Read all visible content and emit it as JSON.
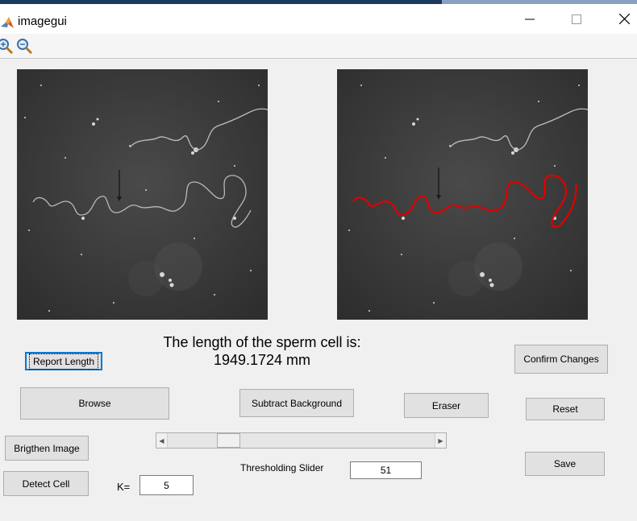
{
  "window": {
    "title": "imagegui"
  },
  "toolbar": {
    "zoom_in_icon": "zoom-in-icon",
    "zoom_out_icon": "zoom-out-icon"
  },
  "result": {
    "line1": "The length of the sperm cell is:",
    "line2": "1949.1724 mm"
  },
  "buttons": {
    "report_length": "Report Length",
    "confirm_changes": "Confirm Changes",
    "browse": "Browse",
    "subtract_background": "Subtract Background",
    "eraser": "Eraser",
    "reset": "Reset",
    "brighten_image": "Brigthen Image",
    "save": "Save",
    "detect_cell": "Detect Cell"
  },
  "slider": {
    "label": "Thresholding Slider",
    "value": "51"
  },
  "k_field": {
    "label": "K=",
    "value": "5"
  },
  "colors": {
    "trace": "#e00000",
    "image_bg": "#3d3d3d",
    "focus": "#0078d7"
  }
}
